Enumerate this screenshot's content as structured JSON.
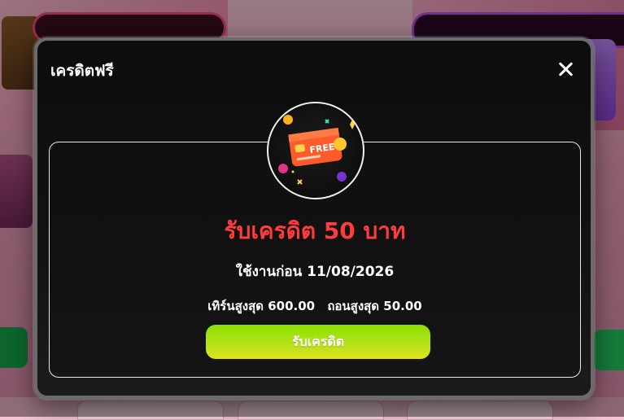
{
  "modal": {
    "title": "เครดิตฟรี",
    "headline": "รับเครดิต 50 บาท",
    "expiry_text": "ใช้งานก่อน 11/08/2026",
    "turnover_text": "เทิร์นสูงสุด 600.00",
    "withdraw_text": "ถอนสูงสุด 50.00",
    "claim_button": "รับเครดิต",
    "badge_card_text": "FREE",
    "colors": {
      "headline": "#ff3b3b",
      "button_top": "#8be000",
      "button_bottom": "#e2e21c",
      "card_orange": "#ff5a2a"
    },
    "icons": [
      "close-icon",
      "free-credit-card-icon"
    ]
  }
}
